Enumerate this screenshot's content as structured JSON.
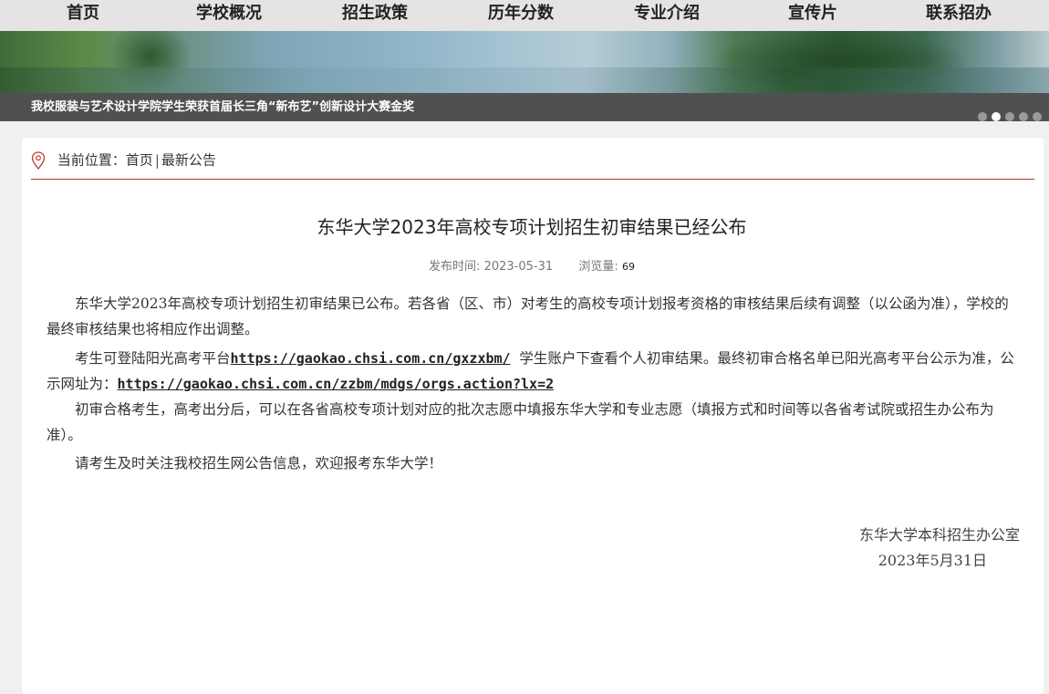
{
  "nav": {
    "items": [
      "首页",
      "学校概况",
      "招生政策",
      "历年分数",
      "专业介绍",
      "宣传片",
      "联系招办"
    ]
  },
  "banner": {
    "caption": "我校服装与艺术设计学院学生荣获首届长三角“新布艺”创新设计大赛金奖",
    "dots_total": 5,
    "active_dot": 2
  },
  "breadcrumb": {
    "label": "当前位置：",
    "home": "首页",
    "separator": "|",
    "current": "最新公告"
  },
  "article": {
    "title": "东华大学2023年高校专项计划招生初审结果已经公布",
    "publish_label": "发布时间:",
    "publish_date": "2023-05-31",
    "views_label": "浏览量:",
    "views": "69",
    "para1": "东华大学2023年高校专项计划招生初审结果已公布。若各省（区、市）对考生的高校专项计划报考资格的审核结果后续有调整（以公函为准），学校的最终审核结果也将相应作出调整。",
    "para2_a": "考生可登陆阳光高考平台",
    "link1": "https://gaokao.chsi.com.cn/gxzxbm/",
    "para2_b": "  学生账户下查看个人初审结果。最终初审合格名单已阳光高考平台公示为准，公示网址为：",
    "link2": "https://gaokao.chsi.com.cn/zzbm/mdgs/orgs.action?lx=2",
    "para3": "初审合格考生，高考出分后，可以在各省高校专项计划对应的批次志愿中填报东华大学和专业志愿（填报方式和时间等以各省考试院或招生办公布为准）。",
    "para4": "请考生及时关注我校招生网公告信息，欢迎报考东华大学！",
    "signature_org": "东华大学本科招生办公室",
    "signature_date": "2023年5月31日"
  }
}
